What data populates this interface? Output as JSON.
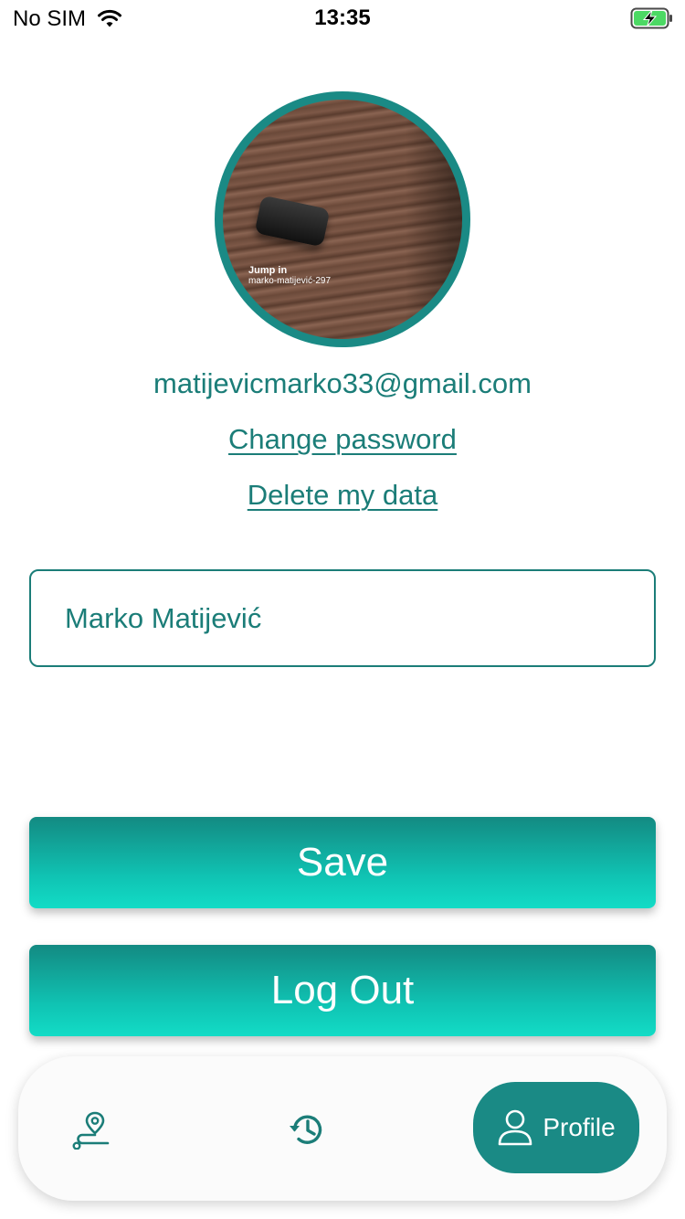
{
  "status_bar": {
    "carrier": "No SIM",
    "time": "13:35",
    "wifi_icon": "wifi-icon",
    "battery_icon": "battery-charging-icon"
  },
  "profile": {
    "avatar_caption_line1": "Jump in",
    "avatar_caption_line2": "marko-matijević-297",
    "email": "matijevicmarko33@gmail.com",
    "change_password_label": "Change password",
    "delete_data_label": "Delete my data",
    "name_value": "Marko Matijević"
  },
  "actions": {
    "save_label": "Save",
    "logout_label": "Log Out"
  },
  "bottom_nav": {
    "items": [
      {
        "icon": "route-pin-icon",
        "label": ""
      },
      {
        "icon": "history-icon",
        "label": ""
      },
      {
        "icon": "user-icon",
        "label": "Profile",
        "active": true
      }
    ]
  },
  "colors": {
    "accent": "#1b7d78",
    "button_gradient_top": "#138a82",
    "button_gradient_bottom": "#12dcc6",
    "battery_green": "#4cd964"
  }
}
